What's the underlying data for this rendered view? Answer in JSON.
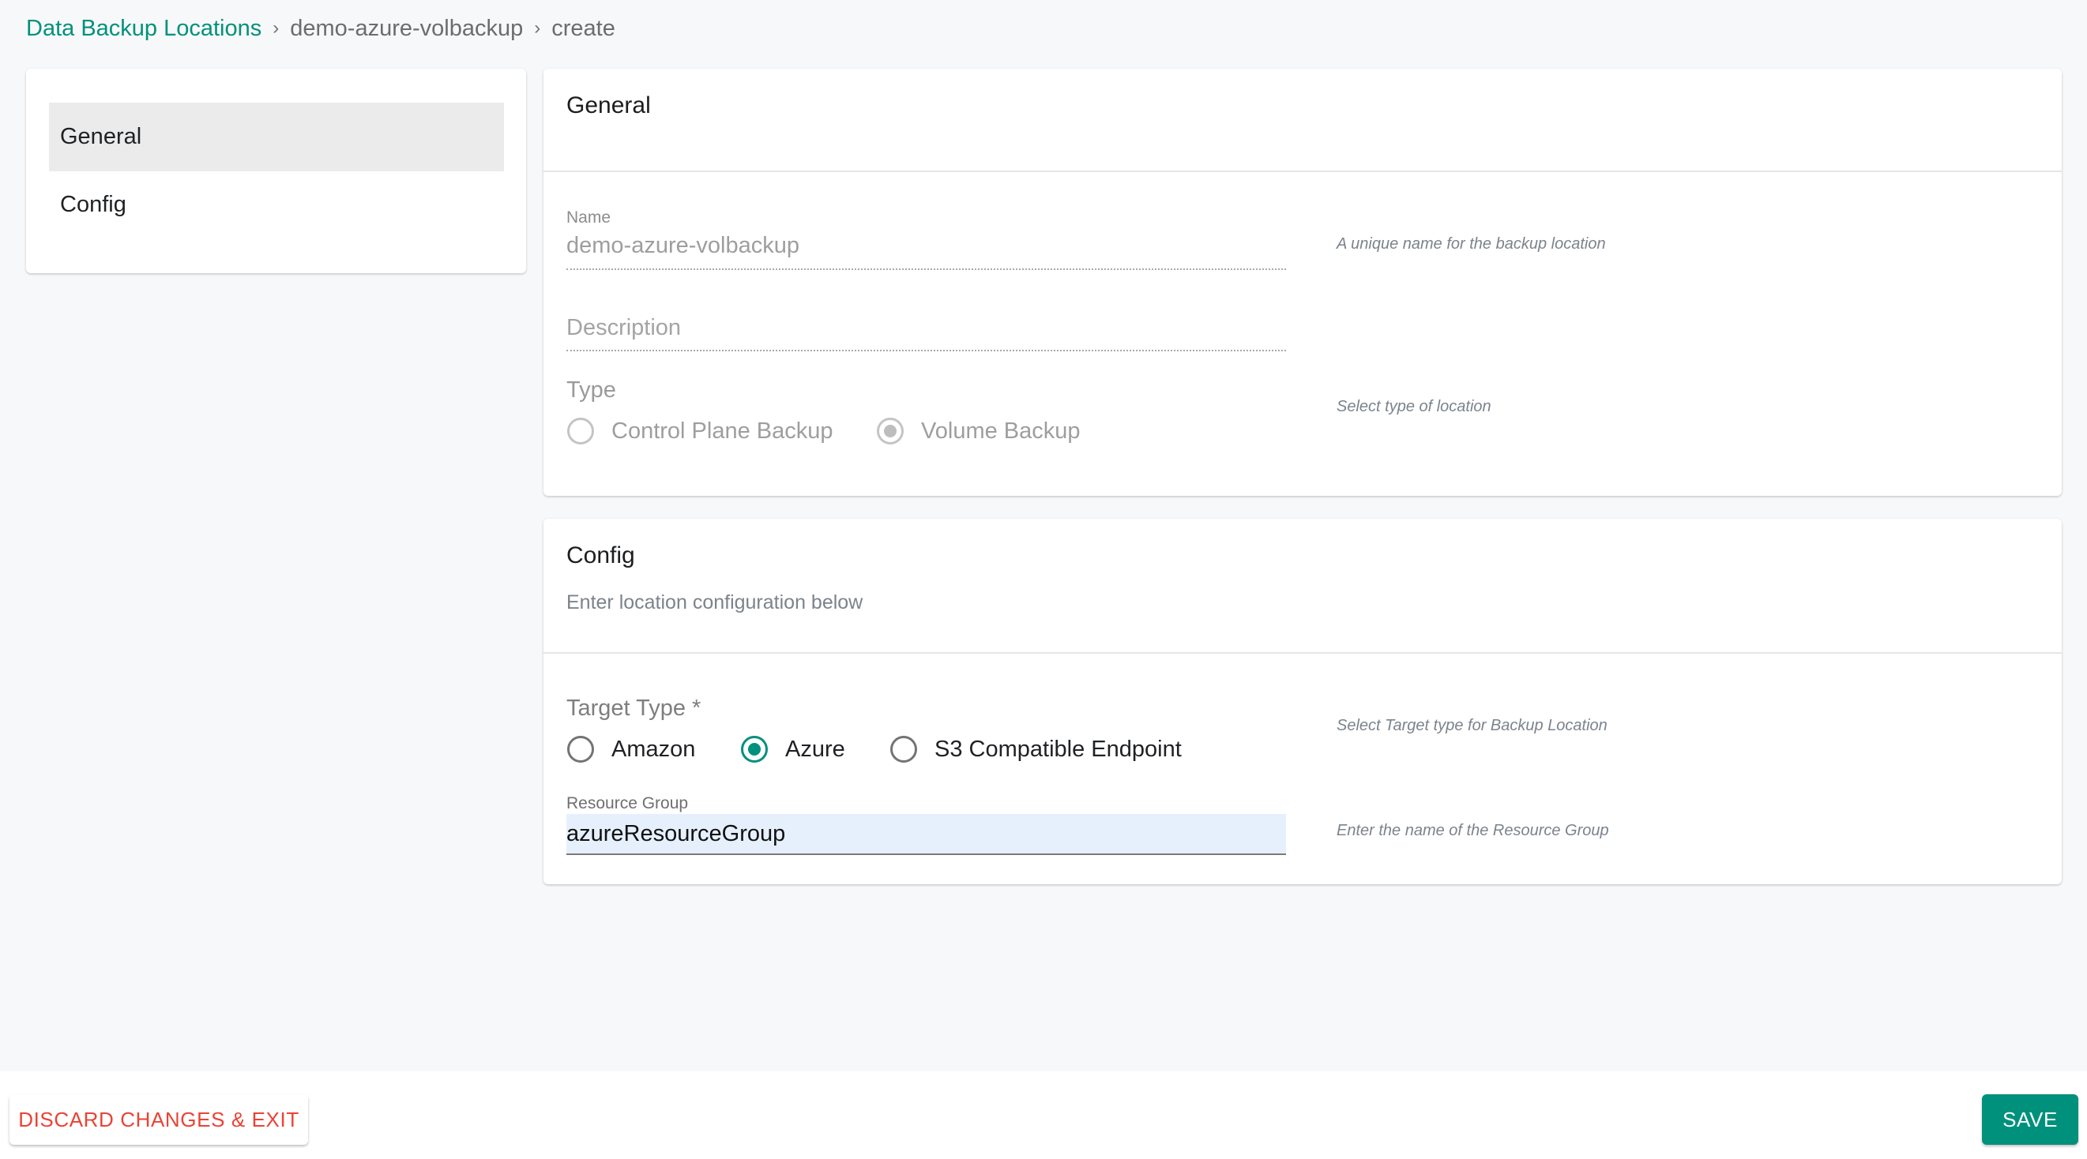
{
  "breadcrumb": {
    "items": [
      "Data Backup Locations",
      "demo-azure-volbackup",
      "create"
    ],
    "separator": "›"
  },
  "sidebar": {
    "items": [
      {
        "label": "General",
        "active": true
      },
      {
        "label": "Config",
        "active": false
      }
    ]
  },
  "general": {
    "title": "General",
    "name": {
      "label": "Name",
      "value": "demo-azure-volbackup",
      "help": "A unique name for the backup location",
      "disabled": true
    },
    "description": {
      "placeholder": "Description",
      "value": "",
      "disabled": true
    },
    "type": {
      "label": "Type",
      "help": "Select type of location",
      "options": [
        {
          "label": "Control Plane Backup",
          "checked": false
        },
        {
          "label": "Volume Backup",
          "checked": true
        }
      ],
      "disabled": true
    }
  },
  "config": {
    "title": "Config",
    "subtitle": "Enter location configuration below",
    "target_type": {
      "label": "Target Type *",
      "help": "Select Target type for Backup Location",
      "options": [
        {
          "label": "Amazon",
          "checked": false
        },
        {
          "label": "Azure",
          "checked": true
        },
        {
          "label": "S3 Compatible Endpoint",
          "checked": false
        }
      ]
    },
    "resource_group": {
      "label": "Resource Group",
      "value": "azureResourceGroup",
      "help": "Enter the name of the Resource Group"
    }
  },
  "footer": {
    "discard_label": "DISCARD CHANGES & EXIT",
    "save_label": "SAVE"
  },
  "colors": {
    "accent": "#00917c",
    "danger": "#ea4335",
    "background": "#f7f8fa"
  }
}
